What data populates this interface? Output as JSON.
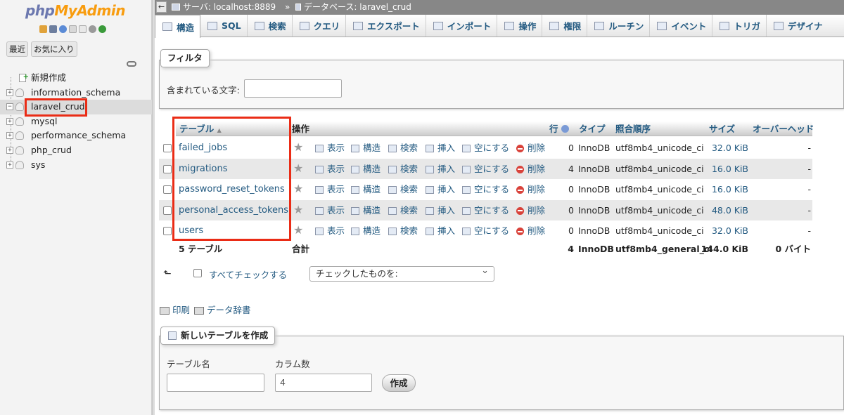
{
  "nav": {
    "logo_php": "php",
    "logo_myadmin": "MyAdmin",
    "tabs": [
      "最近",
      "お気に入り"
    ],
    "tree": [
      {
        "label": "新規作成",
        "type": "new"
      },
      {
        "label": "information_schema",
        "type": "db"
      },
      {
        "label": "laravel_crud",
        "type": "db",
        "selected": true
      },
      {
        "label": "mysql",
        "type": "db"
      },
      {
        "label": "performance_schema",
        "type": "db"
      },
      {
        "label": "php_crud",
        "type": "db"
      },
      {
        "label": "sys",
        "type": "db"
      }
    ]
  },
  "breadcrumb": {
    "server": "サーバ: localhost:8889",
    "separator": "»",
    "database": "データベース: laravel_crud"
  },
  "tabs": [
    {
      "label": "構造",
      "icon": "structure-icon",
      "active": true
    },
    {
      "label": "SQL",
      "icon": "sql-icon"
    },
    {
      "label": "検索",
      "icon": "search-icon"
    },
    {
      "label": "クエリ",
      "icon": "query-icon"
    },
    {
      "label": "エクスポート",
      "icon": "export-icon"
    },
    {
      "label": "インポート",
      "icon": "import-icon"
    },
    {
      "label": "操作",
      "icon": "wrench-icon"
    },
    {
      "label": "権限",
      "icon": "privileges-icon"
    },
    {
      "label": "ルーチン",
      "icon": "routines-icon"
    },
    {
      "label": "イベント",
      "icon": "clock-icon"
    },
    {
      "label": "トリガ",
      "icon": "triggers-icon"
    },
    {
      "label": "デザイナ",
      "icon": "designer-icon"
    }
  ],
  "filter": {
    "legend": "フィルタ",
    "label": "含まれている文字:",
    "placeholder": ""
  },
  "table": {
    "headers": {
      "table": "テーブル",
      "sort_indicator": "▲",
      "action": "操作",
      "rows": "行",
      "type": "タイプ",
      "collation": "照合順序",
      "size": "サイズ",
      "overhead": "オーバーヘッド"
    },
    "actions": {
      "browse": "表示",
      "structure": "構造",
      "search": "検索",
      "insert": "挿入",
      "empty": "空にする",
      "drop": "削除"
    },
    "rows": [
      {
        "name": "failed_jobs",
        "rows": "0",
        "type": "InnoDB",
        "collation": "utf8mb4_unicode_ci",
        "size": "32.0 KiB",
        "overhead": "-"
      },
      {
        "name": "migrations",
        "rows": "4",
        "type": "InnoDB",
        "collation": "utf8mb4_unicode_ci",
        "size": "16.0 KiB",
        "overhead": "-"
      },
      {
        "name": "password_reset_tokens",
        "rows": "0",
        "type": "InnoDB",
        "collation": "utf8mb4_unicode_ci",
        "size": "16.0 KiB",
        "overhead": "-"
      },
      {
        "name": "personal_access_tokens",
        "rows": "0",
        "type": "InnoDB",
        "collation": "utf8mb4_unicode_ci",
        "size": "48.0 KiB",
        "overhead": "-"
      },
      {
        "name": "users",
        "rows": "0",
        "type": "InnoDB",
        "collation": "utf8mb4_unicode_ci",
        "size": "32.0 KiB",
        "overhead": "-"
      }
    ],
    "footer": {
      "count": "5 テーブル",
      "label": "合計",
      "rows": "4",
      "type": "InnoDB",
      "collation": "utf8mb4_general_ci",
      "size": "144.0 KiB",
      "overhead": "0 バイト"
    }
  },
  "bulk": {
    "check_all": "すべてチェックする",
    "with_selected": "チェックしたものを:"
  },
  "links": {
    "print": "印刷",
    "dictionary": "データ辞書"
  },
  "create_table": {
    "legend": "新しいテーブルを作成",
    "name_label": "テーブル名",
    "columns_label": "カラム数",
    "columns_value": "4",
    "button": "作成"
  },
  "colors": {
    "link": "#235a81",
    "highlight": "#ea2c16"
  }
}
